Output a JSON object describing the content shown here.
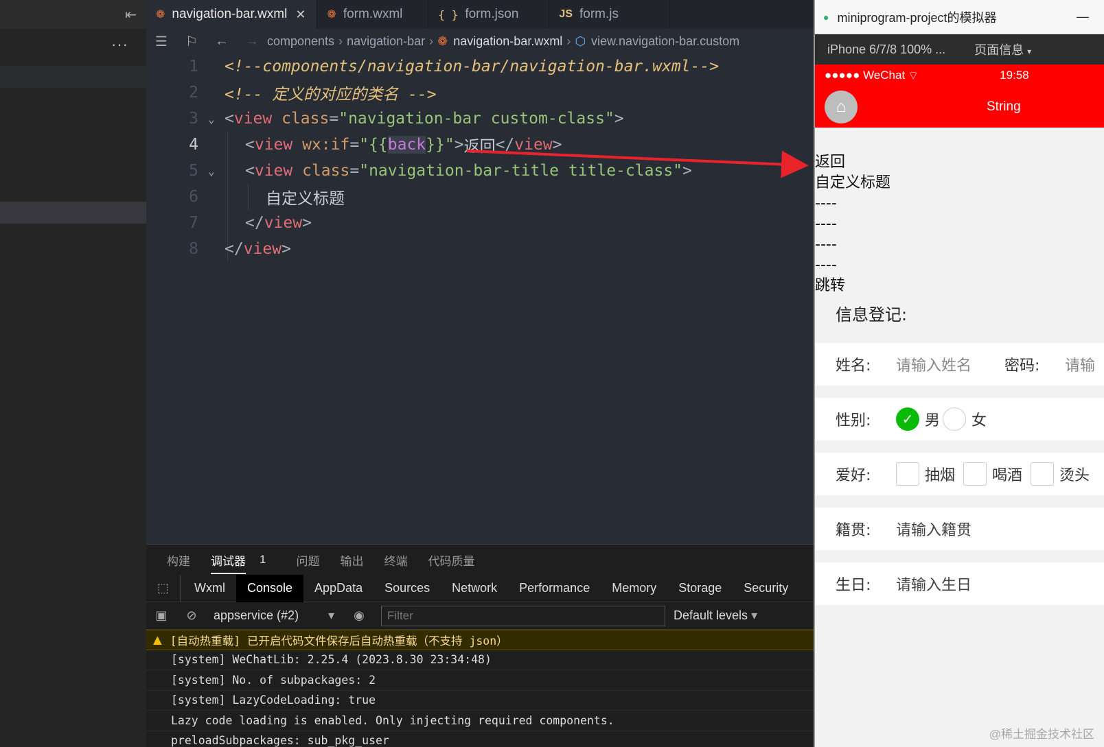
{
  "editor": {
    "tabs": [
      {
        "label": "navigation-bar.wxml",
        "icon": "wechat-icon",
        "active": true
      },
      {
        "label": "form.wxml",
        "icon": "wechat-icon",
        "active": false
      },
      {
        "label": "form.json",
        "icon": "json-icon",
        "active": false
      },
      {
        "label": "form.js",
        "icon": "js-icon",
        "active": false
      }
    ],
    "icon_labels": {
      "json": "{ }",
      "js": "JS"
    },
    "breadcrumb": [
      "components",
      "navigation-bar",
      "navigation-bar.wxml",
      "view.navigation-bar.custom"
    ],
    "line_numbers": [
      "1",
      "2",
      "3",
      "4",
      "5",
      "6",
      "7",
      "8"
    ],
    "code": {
      "l1": "<!--components/navigation-bar/navigation-bar.wxml-->",
      "l2": "<!-- 定义的对应的类名 -->",
      "l3_tag": "view",
      "l3_attr": "class",
      "l3_val": "\"navigation-bar custom-class\"",
      "l4_tag": "view",
      "l4_attr": "wx:if",
      "l4_val_open": "\"{{",
      "l4_var": "back",
      "l4_val_close": "}}\"",
      "l4_text": "返回",
      "l5_tag": "view",
      "l5_attr": "class",
      "l5_val": "\"navigation-bar-title title-class\"",
      "l6_text": "自定义标题",
      "l7_tag": "view",
      "l8_tag": "view"
    }
  },
  "panel": {
    "tabs": [
      "构建",
      "调试器",
      "1",
      "问题",
      "输出",
      "终端",
      "代码质量"
    ],
    "devtools_tabs": [
      "Wxml",
      "Console",
      "AppData",
      "Sources",
      "Network",
      "Performance",
      "Memory",
      "Storage",
      "Security"
    ],
    "context": "appservice (#2)",
    "filter_placeholder": "Filter",
    "levels": "Default levels",
    "console": [
      "[自动热重载] 已开启代码文件保存后自动热重载（不支持 json）",
      "[system] WeChatLib: 2.25.4 (2023.8.30 23:34:48)",
      "[system] No. of subpackages: 2",
      "[system] LazyCodeLoading: true",
      "Lazy code loading is enabled. Only injecting required components.",
      "preloadSubpackages: sub_pkg_user"
    ]
  },
  "simulator": {
    "title": "miniprogram-project的模拟器",
    "device": "iPhone 6/7/8 100% ...",
    "page_info": "页面信息",
    "carrier": "●●●●● WeChat",
    "time": "19:58",
    "nav_title": "String",
    "texts": [
      "返回",
      "自定义标题",
      "----",
      "----",
      "----",
      "----",
      "跳转"
    ],
    "form": {
      "heading": "信息登记:",
      "name_label": "姓名:",
      "name_placeholder": "请输入姓名",
      "pwd_label": "密码:",
      "pwd_placeholder": "请输",
      "gender_label": "性别:",
      "male": "男",
      "female": "女",
      "hobby_label": "爱好:",
      "hobbies": [
        "抽烟",
        "喝酒",
        "烫头"
      ],
      "origin_label": "籍贯:",
      "origin_placeholder": "请输入籍贯",
      "birthday_label": "生日:",
      "birthday_placeholder": "请输入生日"
    },
    "watermark": "@稀土掘金技术社区"
  },
  "colors": {
    "navbar": "#ff0000",
    "radio_checked": "#09bb07",
    "arrow": "#e8232b"
  }
}
